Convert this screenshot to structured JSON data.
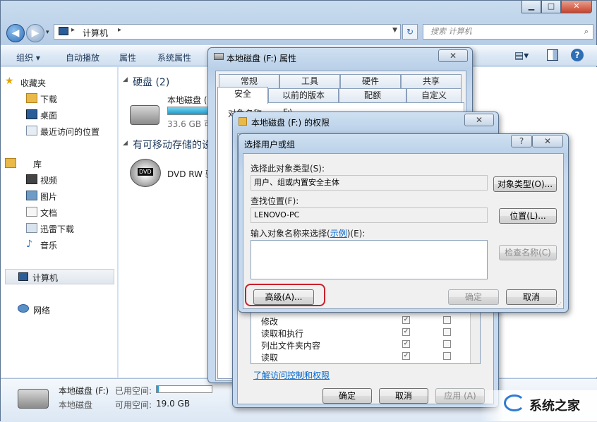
{
  "explorer": {
    "address_root": "计算机",
    "search_placeholder": "搜索 计算机",
    "toolbar": [
      "组织 ▾",
      "自动播放",
      "属性",
      "系统属性"
    ],
    "nav": {
      "favorites": "收藏夹",
      "downloads": "下载",
      "desktop": "桌面",
      "recent": "最近访问的位置",
      "libraries": "库",
      "videos": "视频",
      "pictures": "图片",
      "documents": "文档",
      "thunder": "迅雷下载",
      "music": "音乐",
      "computer": "计算机",
      "network": "网络"
    },
    "groups": {
      "hdd": "硬盘 (2)",
      "removable": "有可移动存储的设"
    },
    "drive_f_name": "本地磁盘 (",
    "drive_f_size": "33.6 GB 可",
    "dvd_name": "DVD RW 驱",
    "details": {
      "name": "本地磁盘 (F:)",
      "used_label": "已用空间:",
      "type": "本地磁盘",
      "free_label": "可用空间:",
      "free_value": "19.0 GB"
    }
  },
  "properties": {
    "title": "本地磁盘 (F:) 属性",
    "tabs_row1": [
      "常规",
      "工具",
      "硬件",
      "共享"
    ],
    "tabs_row2": [
      "安全",
      "以前的版本",
      "配额",
      "自定义"
    ],
    "object_name_label": "对象名称:",
    "object_name_value": "F:\\"
  },
  "permissions": {
    "title": "本地磁盘 (F:) 的权限",
    "perm_rows": [
      "修改",
      "读取和执行",
      "列出文件夹内容",
      "读取"
    ],
    "link": "了解访问控制和权限",
    "ok": "确定",
    "cancel": "取消",
    "apply": "应用 (A)"
  },
  "select_dialog": {
    "title": "选择用户或组",
    "object_type_label": "选择此对象类型(S):",
    "object_type_value": "用户、组或内置安全主体",
    "object_type_button": "对象类型(O)...",
    "location_label": "查找位置(F):",
    "location_value": "LENOVO-PC",
    "location_button": "位置(L)...",
    "names_label_pre": "输入对象名称来选择(",
    "names_label_link": "示例",
    "names_label_post": ")(E):",
    "check_names_button": "检查名称(C)",
    "advanced_button": "高级(A)...",
    "ok_button": "确定",
    "cancel_button": "取消",
    "help_glyph": "?",
    "close_glyph": "✕"
  },
  "watermark": "系统之家",
  "colors": {
    "highlight": "#c8202a",
    "link": "#0066cc",
    "progress": "#26a0da"
  }
}
